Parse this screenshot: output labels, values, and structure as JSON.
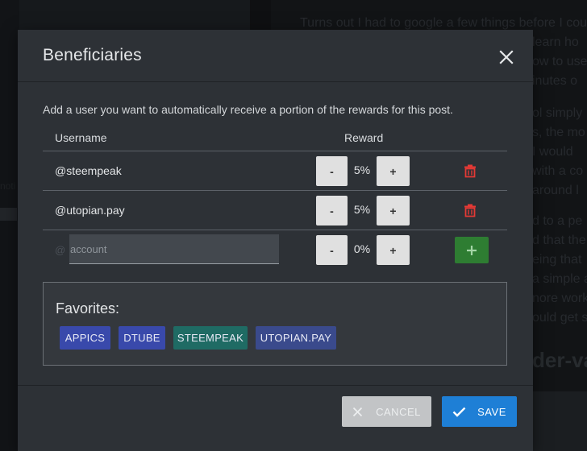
{
  "background": {
    "article_lines": [
      "Turns out I had to google a few things before I cou",
      "learn ho",
      "ow to use",
      "inutes o",
      "ol simply",
      "s, the mo",
      "I would",
      "with a co",
      "around l",
      "d to a pe",
      "d that the",
      "eing that",
      "a simple a",
      "nore work",
      "ould get s"
    ],
    "article_heading": "der-va",
    "left_texts": [
      "noti"
    ]
  },
  "modal": {
    "title": "Beneficiaries",
    "close_icon": "close-icon",
    "description": "Add a user you want to automatically receive a portion of the rewards for this post.",
    "table": {
      "headers": {
        "username": "Username",
        "reward": "Reward"
      },
      "rows": [
        {
          "username": "@steempeak",
          "reward": "5%",
          "minus": "-",
          "plus": "+",
          "delete_icon": "trash-icon"
        },
        {
          "username": "@utopian.pay",
          "reward": "5%",
          "minus": "-",
          "plus": "+",
          "delete_icon": "trash-icon"
        }
      ],
      "new_row": {
        "at_sign": "@",
        "placeholder": "account",
        "value": "",
        "reward": "0%",
        "minus": "-",
        "plus": "+",
        "add_icon": "plus-icon"
      }
    },
    "favorites": {
      "title": "Favorites:",
      "chips": [
        {
          "label": "APPICS",
          "color": "#3949ab"
        },
        {
          "label": "DTUBE",
          "color": "#3949ab"
        },
        {
          "label": "STEEMPEAK",
          "color": "#1f6b64"
        },
        {
          "label": "UTOPIAN.PAY",
          "color": "#3a4a8c"
        }
      ]
    },
    "footer": {
      "cancel_label": "CANCEL",
      "cancel_icon": "close-icon",
      "save_label": "SAVE",
      "save_icon": "check-icon"
    }
  },
  "colors": {
    "delete": "#e53935",
    "add": "#2e7d32",
    "save": "#1e7fd6",
    "cancel": "#c2c4c6"
  }
}
